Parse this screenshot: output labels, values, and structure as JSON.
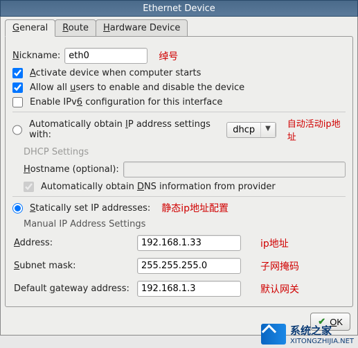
{
  "window": {
    "title": "Ethernet Device"
  },
  "tabs": [
    {
      "label_pre": "",
      "label_u": "G",
      "label_post": "eneral",
      "active": true
    },
    {
      "label_pre": "",
      "label_u": "R",
      "label_post": "oute",
      "active": false
    },
    {
      "label_pre": "",
      "label_u": "H",
      "label_post": "ardware Device",
      "active": false
    }
  ],
  "general": {
    "nickname_label_pre": "",
    "nickname_label_u": "N",
    "nickname_label_post": "ickname:",
    "nickname_value": "eth0",
    "nickname_annot": "绰号",
    "activate_label_pre": "",
    "activate_label_u": "A",
    "activate_label_post": "ctivate device when computer starts",
    "activate_checked": true,
    "allowusers_label_pre": "Allow all ",
    "allowusers_label_u": "u",
    "allowusers_label_post": "sers to enable and disable the device",
    "allowusers_checked": true,
    "ipv6_label_pre": "Enable IPv",
    "ipv6_label_u": "6",
    "ipv6_label_post": " configuration for this interface",
    "ipv6_checked": false,
    "auto_label": "Automatically obtain IP address settings with:",
    "auto_label_u": "I",
    "auto_label_pre": "Automatically obtain ",
    "auto_label_post": "P address settings with:",
    "auto_selected": false,
    "auto_proto": "dhcp",
    "auto_annot": "自动活动ip地址",
    "dhcp_section": "DHCP Settings",
    "hostname_label_pre": "",
    "hostname_label_u": "H",
    "hostname_label_post": "ostname (optional):",
    "hostname_value": "",
    "autodns_label_pre": "Automatically obtain ",
    "autodns_label_u": "D",
    "autodns_label_post": "NS information from provider",
    "autodns_checked": true,
    "static_label_pre": "",
    "static_label_u": "S",
    "static_label_post": "tatically set IP addresses:",
    "static_selected": true,
    "static_annot": "静态ip地址配置",
    "manual_section": "Manual IP Address Settings",
    "address_label_pre": "",
    "address_label_u": "A",
    "address_label_post": "ddress:",
    "address_value": "192.168.1.33",
    "address_annot": "ip地址",
    "subnet_label_pre": "",
    "subnet_label_u": "S",
    "subnet_label_post": "ubnet mask:",
    "subnet_value": "255.255.255.0",
    "subnet_annot": "子网掩码",
    "gateway_label_pre": "Default ",
    "gateway_label_u": "g",
    "gateway_label_post": "ateway address:",
    "gateway_value": "192.168.1.3",
    "gateway_annot": "默认网关"
  },
  "footer": {
    "ok_label": "OK",
    "ok_u": "O",
    "ok_post": "K"
  },
  "watermark": {
    "line1": "系统之家",
    "line2": "XITONGZHIJIA.NET"
  }
}
